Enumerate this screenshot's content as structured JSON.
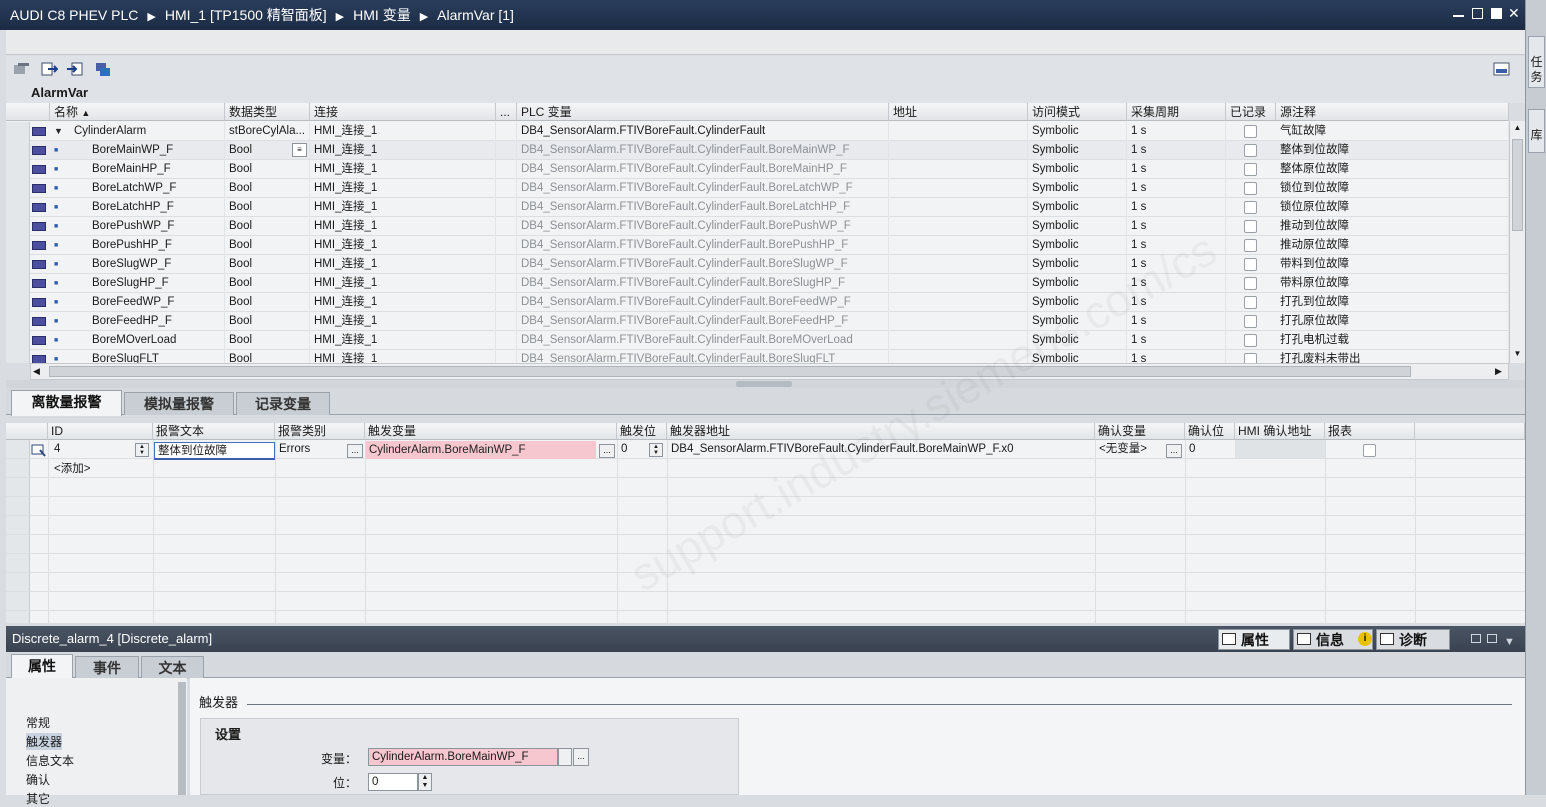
{
  "titlebar": {
    "crumbs": [
      "AUDI C8 PHEV PLC",
      "HMI_1 [TP1500 精智面板]",
      "HMI 变量",
      "AlarmVar [1]"
    ]
  },
  "rightbar": {
    "tabs": [
      "任务",
      "库"
    ]
  },
  "editor": {
    "title": "AlarmVar"
  },
  "tag_table": {
    "headers": {
      "name": "名称",
      "datatype": "数据类型",
      "connection": "连接",
      "dots": "...",
      "plc_tag": "PLC 变量",
      "address": "地址",
      "access": "访问模式",
      "cycle": "采集周期",
      "logged": "已记录",
      "comment": "源注释"
    },
    "rows": [
      {
        "name": "CylinderAlarm",
        "datatype": "stBoreCylAla...",
        "connection": "HMI_连接_1",
        "plc_tag": "DB4_SensorAlarm.FTIVBoreFault.CylinderFault",
        "access": "Symbolic",
        "cycle": "1 s",
        "comment": "气缸故障"
      },
      {
        "name": "BoreMainWP_F",
        "datatype": "Bool",
        "connection": "HMI_连接_1",
        "plc_tag": "DB4_SensorAlarm.FTIVBoreFault.CylinderFault.BoreMainWP_F",
        "access": "Symbolic",
        "cycle": "1 s",
        "comment": "整体到位故障"
      },
      {
        "name": "BoreMainHP_F",
        "datatype": "Bool",
        "connection": "HMI_连接_1",
        "plc_tag": "DB4_SensorAlarm.FTIVBoreFault.CylinderFault.BoreMainHP_F",
        "access": "Symbolic",
        "cycle": "1 s",
        "comment": "整体原位故障"
      },
      {
        "name": "BoreLatchWP_F",
        "datatype": "Bool",
        "connection": "HMI_连接_1",
        "plc_tag": "DB4_SensorAlarm.FTIVBoreFault.CylinderFault.BoreLatchWP_F",
        "access": "Symbolic",
        "cycle": "1 s",
        "comment": "锁位到位故障"
      },
      {
        "name": "BoreLatchHP_F",
        "datatype": "Bool",
        "connection": "HMI_连接_1",
        "plc_tag": "DB4_SensorAlarm.FTIVBoreFault.CylinderFault.BoreLatchHP_F",
        "access": "Symbolic",
        "cycle": "1 s",
        "comment": "锁位原位故障"
      },
      {
        "name": "BorePushWP_F",
        "datatype": "Bool",
        "connection": "HMI_连接_1",
        "plc_tag": "DB4_SensorAlarm.FTIVBoreFault.CylinderFault.BorePushWP_F",
        "access": "Symbolic",
        "cycle": "1 s",
        "comment": "推动到位故障"
      },
      {
        "name": "BorePushHP_F",
        "datatype": "Bool",
        "connection": "HMI_连接_1",
        "plc_tag": "DB4_SensorAlarm.FTIVBoreFault.CylinderFault.BorePushHP_F",
        "access": "Symbolic",
        "cycle": "1 s",
        "comment": "推动原位故障"
      },
      {
        "name": "BoreSlugWP_F",
        "datatype": "Bool",
        "connection": "HMI_连接_1",
        "plc_tag": "DB4_SensorAlarm.FTIVBoreFault.CylinderFault.BoreSlugWP_F",
        "access": "Symbolic",
        "cycle": "1 s",
        "comment": "带料到位故障"
      },
      {
        "name": "BoreSlugHP_F",
        "datatype": "Bool",
        "connection": "HMI_连接_1",
        "plc_tag": "DB4_SensorAlarm.FTIVBoreFault.CylinderFault.BoreSlugHP_F",
        "access": "Symbolic",
        "cycle": "1 s",
        "comment": "带料原位故障"
      },
      {
        "name": "BoreFeedWP_F",
        "datatype": "Bool",
        "connection": "HMI_连接_1",
        "plc_tag": "DB4_SensorAlarm.FTIVBoreFault.CylinderFault.BoreFeedWP_F",
        "access": "Symbolic",
        "cycle": "1 s",
        "comment": "打孔到位故障"
      },
      {
        "name": "BoreFeedHP_F",
        "datatype": "Bool",
        "connection": "HMI_连接_1",
        "plc_tag": "DB4_SensorAlarm.FTIVBoreFault.CylinderFault.BoreFeedHP_F",
        "access": "Symbolic",
        "cycle": "1 s",
        "comment": "打孔原位故障"
      },
      {
        "name": "BoreMOverLoad",
        "datatype": "Bool",
        "connection": "HMI_连接_1",
        "plc_tag": "DB4_SensorAlarm.FTIVBoreFault.CylinderFault.BoreMOverLoad",
        "access": "Symbolic",
        "cycle": "1 s",
        "comment": "打孔电机过载"
      },
      {
        "name": "BoreSlugFLT",
        "datatype": "Bool",
        "connection": "HMI_连接_1",
        "plc_tag": "DB4_SensorAlarm.FTIVBoreFault.CylinderFault.BoreSlugFLT",
        "access": "Symbolic",
        "cycle": "1 s",
        "comment": "打孔废料未带出"
      }
    ]
  },
  "alarm_tabs": [
    "离散量报警",
    "模拟量报警",
    "记录变量"
  ],
  "alarm_table": {
    "headers": {
      "id": "ID",
      "text": "报警文本",
      "class": "报警类别",
      "trigger_tag": "触发变量",
      "trigger_bit": "触发位",
      "trigger_addr": "触发器地址",
      "ack_tag": "确认变量",
      "ack_bit": "确认位",
      "hmi_ack_addr": "HMI 确认地址",
      "report": "报表"
    },
    "row": {
      "id": "4",
      "text": "整体到位故障",
      "class": "Errors",
      "trigger_tag": "CylinderAlarm.BoreMainWP_F",
      "trigger_bit": "0",
      "trigger_addr": "DB4_SensorAlarm.FTIVBoreFault.CylinderFault.BoreMainWP_F.x0",
      "ack_tag": "<无变量>",
      "ack_bit": "0"
    },
    "add": "<添加>"
  },
  "inspector": {
    "title": "Discrete_alarm_4 [Discrete_alarm]",
    "right_tabs": [
      "属性",
      "信息",
      "诊断"
    ],
    "tabs": [
      "属性",
      "事件",
      "文本"
    ],
    "nav": [
      "常规",
      "触发器",
      "信息文本",
      "确认",
      "其它"
    ],
    "section": "触发器",
    "group": "设置",
    "tag_label": "变量：",
    "tag_value": "CylinderAlarm.BoreMainWP_F",
    "bit_label": "位：",
    "bit_value": "0"
  },
  "colors": {
    "title_bg": "#1b2b44",
    "highlight_pink": "#f7c7cf",
    "accent_blue": "#3b5ea8"
  }
}
